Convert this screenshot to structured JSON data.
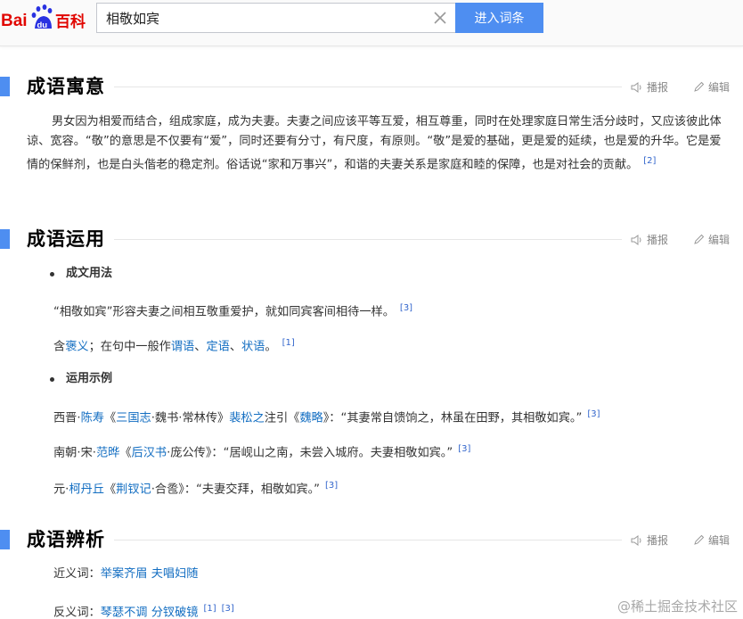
{
  "header": {
    "logo": {
      "bai": "Bai",
      "du": "du",
      "baike": "百科"
    },
    "search_value": "相敬如宾",
    "search_button": "进入词条"
  },
  "tools": {
    "play": "播报",
    "edit": "编辑"
  },
  "section1": {
    "title": "成语寓意",
    "para": "男女因为相爱而结合，组成家庭，成为夫妻。夫妻之间应该平等互爱，相互尊重，同时在处理家庭日常生活分歧时，又应该彼此体谅、宽容。“敬”的意思是不仅要有“爱”，同时还要有分寸，有尺度，有原则。“敬”是爱的基础，更是爱的延续，也是爱的升华。它是爱情的保鲜剂，也是白头偕老的稳定剂。俗话说“家和万事兴”，和谐的夫妻关系是家庭和睦的保障，也是对社会的贡献。",
    "ref": "[2]"
  },
  "section2": {
    "title": "成语运用",
    "sub1": "成文用法",
    "line1": "“相敬如宾”形容夫妻之间相互敬重爱护，就如同宾客间相待一样。",
    "line1_ref": "[3]",
    "line2": {
      "pre": "含",
      "l1": "褒义",
      "mid": "；在句中一般作",
      "l2": "谓语",
      "s1": "、",
      "l3": "定语",
      "s2": "、",
      "l4": "状语",
      "end": "。",
      "ref": "[1]"
    },
    "sub2": "运用示例",
    "ex1": {
      "a": "西晋·",
      "l1": "陈寿",
      "b": "《",
      "l2": "三国志",
      "c": "·魏书·常林传》",
      "l3": "裴松之",
      "d": "注引《",
      "l4": "魏略",
      "e": "》：“其妻常自馈饷之，林虽在田野，其相敬如宾。”",
      "ref": "[3]"
    },
    "ex2": {
      "a": "南朝·宋·",
      "l1": "范晔",
      "b": "《",
      "l2": "后汉书",
      "c": "·庞公传》：“居岘山之南，未尝入城府。夫妻相敬如宾。”",
      "ref": "[3]"
    },
    "ex3": {
      "a": "元·",
      "l1": "柯丹丘",
      "b": "《",
      "l2": "荆钗记",
      "c": "·合卺》：“夫妻交拜，相敬如宾。”",
      "ref": "[3]"
    }
  },
  "section3": {
    "title": "成语辨析",
    "syn_label": "近义词：",
    "syn1": "举案齐眉",
    "syn2": "夫唱妇随",
    "ant_label": "反义词：",
    "ant1": "琴瑟不调",
    "ant2": "分钗破镜",
    "ant_ref1": "[1]",
    "ant_ref2": "[3]"
  },
  "watermark": "@稀土掘金技术社区",
  "colors": {
    "accent": "#4e8ef1",
    "link": "#136ec2",
    "logo_red": "#e10601",
    "logo_blue": "#2932e1"
  }
}
